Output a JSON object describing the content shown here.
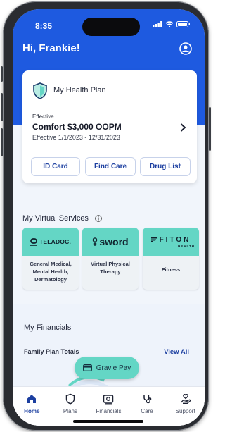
{
  "status": {
    "time": "8:35"
  },
  "header": {
    "greeting": "Hi, Frankie!"
  },
  "plan_card": {
    "title": "My Health Plan",
    "effective_label": "Effective",
    "plan_name": "Comfort $3,000 OOPM",
    "dates": "Effective 1/1/2023 - 12/31/2023",
    "buttons": [
      "ID Card",
      "Find Care",
      "Drug List"
    ]
  },
  "virtual_services": {
    "title": "My Virtual Services",
    "cards": [
      {
        "logo": "TELADOC.",
        "description": "General Medical, Mental Health, Dermatology"
      },
      {
        "logo": "sword",
        "description": "Virtual Physical Therapy"
      },
      {
        "logo": "FITON",
        "logo_sub": "HEALTH",
        "description": "Fitness"
      }
    ]
  },
  "financials": {
    "title": "My Financials",
    "family_label": "Family Plan Totals",
    "view_all": "View All"
  },
  "gravie_pay": {
    "label": "Gravie Pay"
  },
  "tabs": [
    {
      "label": "Home",
      "icon": "home-icon",
      "active": true
    },
    {
      "label": "Plans",
      "icon": "shield-icon",
      "active": false
    },
    {
      "label": "Financials",
      "icon": "dollar-card-icon",
      "active": false
    },
    {
      "label": "Care",
      "icon": "stethoscope-icon",
      "active": false
    },
    {
      "label": "Support",
      "icon": "support-heart-icon",
      "active": false
    }
  ],
  "colors": {
    "brand_blue": "#1e5ae0",
    "accent_teal": "#64d6c5",
    "link_blue": "#1c3fa0"
  }
}
